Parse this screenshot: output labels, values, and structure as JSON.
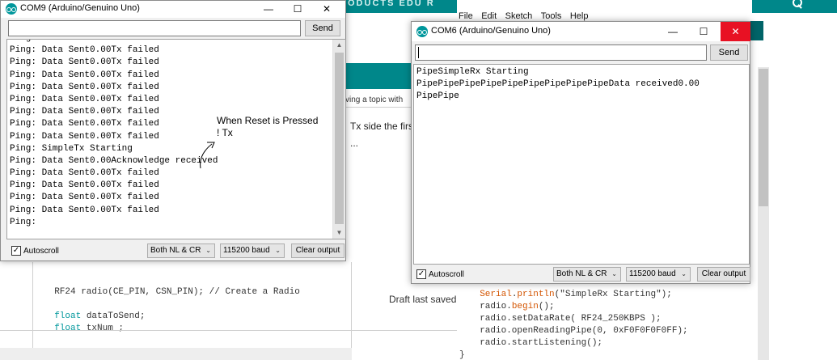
{
  "background": {
    "nav_text": "ODUCTS    EDU    R",
    "forum_hint": "ving a topic with",
    "forum_line2": "Tx side the firs",
    "forum_line3": "...",
    "draft_text": "Draft last saved",
    "code_lines": [
      "RF24 radio(CE_PIN, CSN_PIN); // Create a Radio",
      "",
      "float dataToSend;",
      "float txNum ;"
    ],
    "ide_menu": [
      "File",
      "Edit",
      "Sketch",
      "Tools",
      "Help"
    ],
    "ide_code_lines": [
      "  Serial.println(\"SimpleRx Starting\");",
      "  radio.begin();",
      "  radio.setDataRate( RF24_250KBPS );",
      "  radio.openReadingPipe(0, 0xF0F0F0F0FF);",
      "  radio.startListening();",
      "}"
    ]
  },
  "com9": {
    "title": "COM9 (Arduino/Genuino Uno)",
    "send_label": "Send",
    "input_value": "",
    "output_lines": [
      "Ping: Data Sent0.00Tx failed",
      "Ping: Data Sent0.00Tx failed",
      "Ping: Data Sent0.00Tx failed",
      "Ping: Data Sent0.00Tx failed",
      "Ping: Data Sent0.00Tx failed",
      "Ping: Data Sent0.00Tx failed",
      "Ping: Data Sent0.00Tx failed",
      "Ping: Data Sent0.00Tx failed",
      "Ping: Data Sent0.00Tx failed",
      "Ping: SimpleTx Starting",
      "Ping: Data Sent0.00Acknowledge received",
      "Ping: Data Sent0.00Tx failed",
      "Ping: Data Sent0.00Tx failed",
      "Ping: Data Sent0.00Tx failed",
      "Ping: Data Sent0.00Tx failed",
      "Ping:"
    ],
    "autoscroll_label": "Autoscroll",
    "autoscroll_checked": true,
    "line_ending": "Both NL & CR",
    "baud": "115200 baud",
    "clear_label": "Clear output"
  },
  "com6": {
    "title": "COM6 (Arduino/Genuino Uno)",
    "send_label": "Send",
    "input_value": "",
    "output_lines": [
      "PipeSimpleRx Starting",
      "PipePipePipePipePipePipePipePipePipeData received0.00",
      "PipePipe"
    ],
    "autoscroll_label": "Autoscroll",
    "autoscroll_checked": true,
    "line_ending": "Both NL & CR",
    "baud": "115200 baud",
    "clear_label": "Clear output"
  },
  "annotation": {
    "text": "When Reset is Pressed\n! Tx"
  },
  "colors": {
    "arduino_teal": "#00878a",
    "close_red": "#e81123"
  }
}
